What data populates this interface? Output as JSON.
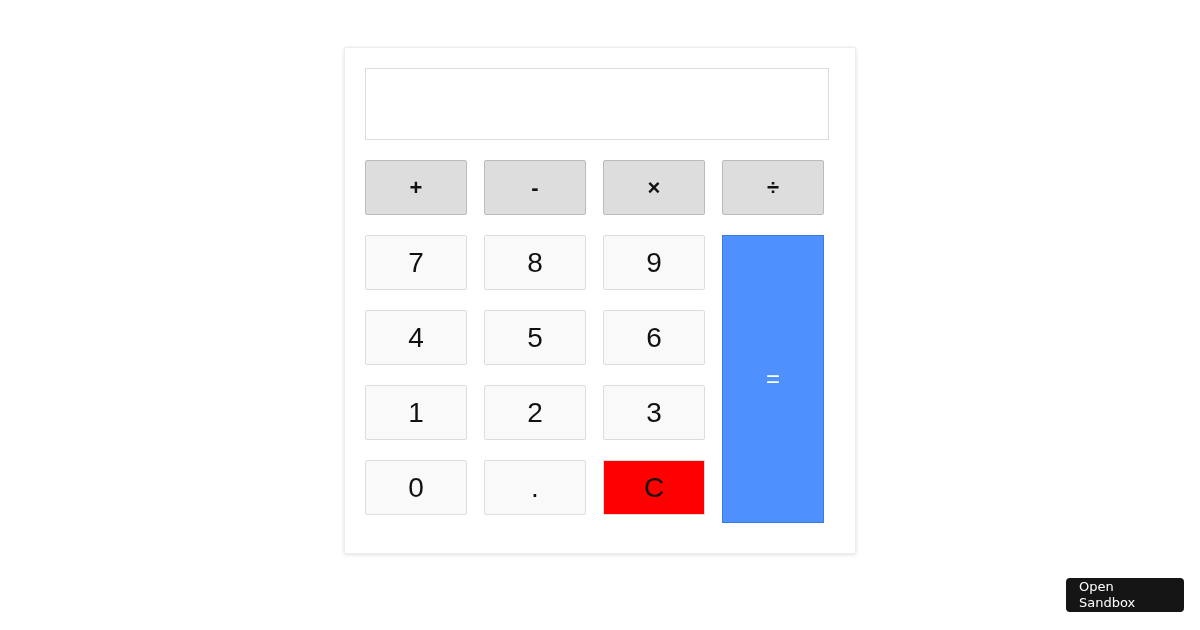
{
  "keys": [
    {
      "label": "+",
      "kind": "operator"
    },
    {
      "label": "-",
      "kind": "operator"
    },
    {
      "label": "×",
      "kind": "operator"
    },
    {
      "label": "÷",
      "kind": "operator"
    },
    {
      "label": "7",
      "kind": "digit"
    },
    {
      "label": "8",
      "kind": "digit"
    },
    {
      "label": "9",
      "kind": "digit"
    },
    {
      "label": "=",
      "kind": "equals"
    },
    {
      "label": "4",
      "kind": "digit"
    },
    {
      "label": "5",
      "kind": "digit"
    },
    {
      "label": "6",
      "kind": "digit"
    },
    {
      "label": "1",
      "kind": "digit"
    },
    {
      "label": "2",
      "kind": "digit"
    },
    {
      "label": "3",
      "kind": "digit"
    },
    {
      "label": "0",
      "kind": "digit"
    },
    {
      "label": ".",
      "kind": "digit"
    },
    {
      "label": "C",
      "kind": "clear"
    }
  ],
  "sandbox_button": {
    "label": "Open Sandbox"
  }
}
